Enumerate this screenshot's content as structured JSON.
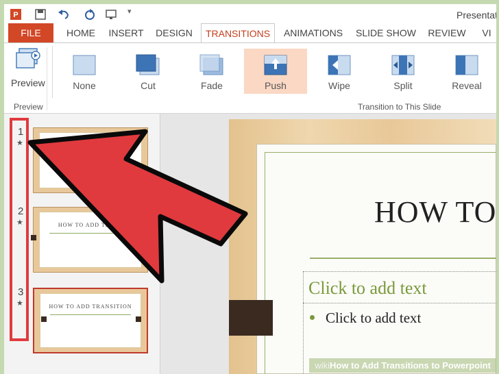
{
  "window": {
    "title": "Presentat"
  },
  "tabs": [
    {
      "label": "FILE"
    },
    {
      "label": "HOME"
    },
    {
      "label": "INSERT"
    },
    {
      "label": "DESIGN"
    },
    {
      "label": "TRANSITIONS"
    },
    {
      "label": "ANIMATIONS"
    },
    {
      "label": "SLIDE SHOW"
    },
    {
      "label": "REVIEW"
    },
    {
      "label": "VI"
    }
  ],
  "ribbon": {
    "preview_button": "Preview",
    "preview_group": "Preview",
    "transitions_group": "Transition to This Slide",
    "transitions": [
      {
        "label": "None"
      },
      {
        "label": "Cut"
      },
      {
        "label": "Fade"
      },
      {
        "label": "Push"
      },
      {
        "label": "Wipe"
      },
      {
        "label": "Split"
      },
      {
        "label": "Reveal"
      }
    ],
    "selected_transition": "Push"
  },
  "slides": [
    {
      "number": "1",
      "star": "★",
      "title": ""
    },
    {
      "number": "2",
      "star": "★",
      "title": "HOW TO ADD TRANS"
    },
    {
      "number": "3",
      "star": "★",
      "title": "HOW TO ADD TRANSITION"
    }
  ],
  "slide": {
    "title": "HOW TO",
    "content_heading": "Click to add text",
    "content_bullet": "Click to add text"
  },
  "watermark": {
    "prefix": "wiki",
    "text": "How to Add Transitions to Powerpoint"
  },
  "colors": {
    "accent": "#d24726",
    "arrow": "#e03a3e",
    "frame": "#c5d9b0"
  }
}
